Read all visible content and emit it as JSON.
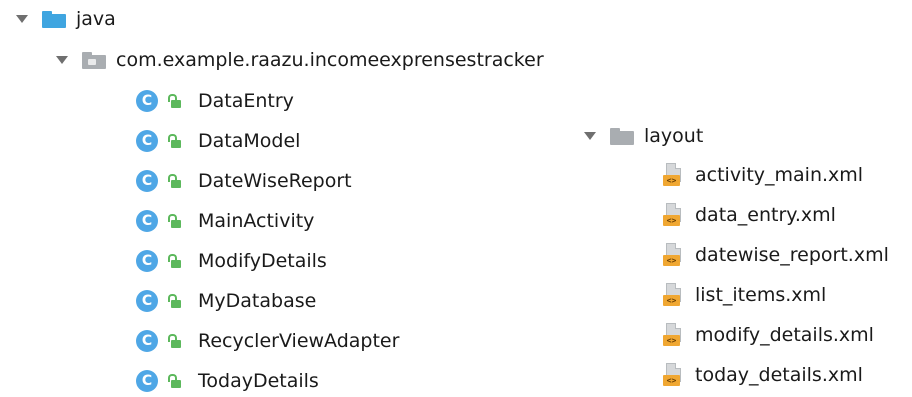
{
  "project_tree": {
    "java": {
      "label": "java",
      "package": {
        "label": "com.example.raazu.incomeexprensestracker",
        "class_badge": "C",
        "classes": [
          "DataEntry",
          "DataModel",
          "DateWiseReport",
          "MainActivity",
          "ModifyDetails",
          "MyDatabase",
          "RecyclerViewAdapter",
          "TodayDetails"
        ]
      }
    },
    "layout": {
      "label": "layout",
      "xml_badge": "<>",
      "files": [
        "activity_main.xml",
        "data_entry.xml",
        "datewise_report.xml",
        "list_items.xml",
        "modify_details.xml",
        "today_details.xml"
      ]
    }
  },
  "colors": {
    "java_folder": "#3fa5e0",
    "package_folder": "#a9adb1",
    "class_icon": "#4fa7e6",
    "access_icon": "#5cb85c",
    "xml_badge": "#f0a732"
  },
  "icons": {
    "expand": "chevron-down-icon",
    "java_folder": "folder-icon",
    "package": "package-icon",
    "class": "class-icon",
    "access": "public-lock-icon",
    "xml": "xml-file-icon"
  }
}
